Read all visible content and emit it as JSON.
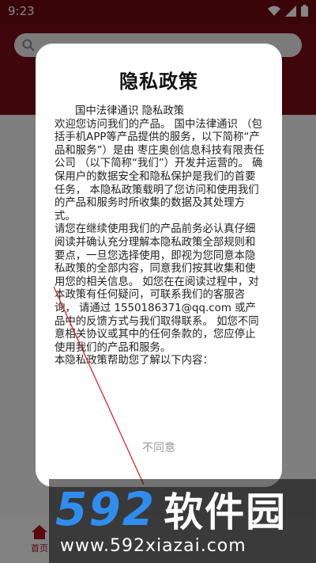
{
  "status_bar": {
    "time": "9:23"
  },
  "bottom_nav": {
    "home_label": "首页"
  },
  "dialog": {
    "title": "隐私政策",
    "paragraphs": [
      "国中法律通识 隐私政策",
      "欢迎您访问我们的产品。 国中法律通识 （包括手机APP等产品提供的服务，以下简称“产品和服务”）是由 枣庄奥创信息科技有限责任公司 （以下简称“我们”）开发并运营的。 确保用户的数据安全和隐私保护是我们的首要任务， 本隐私政策载明了您访问和使用我们的产品和服务时所收集的数据及其处理方式。",
      "请您在继续使用我们的产品前务必认真仔细阅读并确认充分理解本隐私政策全部规则和要点，一旦您选择使用，即视为您同意本隐私政策的全部内容，同意我们按其收集和使用您的相关信息。 如您在在阅读过程中，对本政策有任何疑问，可联系我们的客服咨询， 请通过 1550186371@qq.com 或产品中的反馈方式与我们取得联系。 如您不同意相关协议或其中的任何条款的，您应停止使用我们的产品和服务。",
      "本隐私政策帮助您了解以下内容："
    ],
    "disagree_label": "不同意"
  },
  "watermark": {
    "logo_number": "592",
    "logo_text": "软件园",
    "url": "www.592xiazai.com"
  }
}
